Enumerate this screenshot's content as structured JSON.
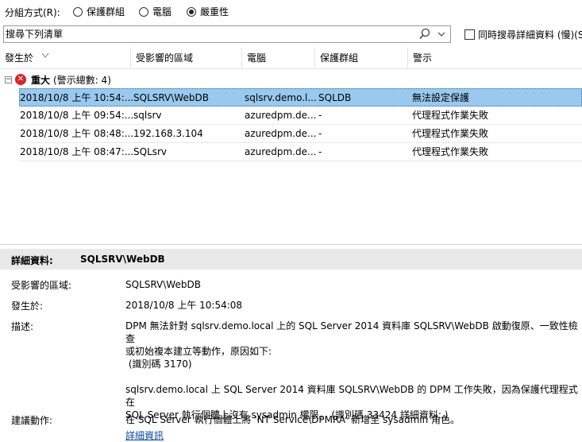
{
  "group_by": {
    "label": "分組方式(R):",
    "options": [
      {
        "label": "保護群組",
        "selected": false
      },
      {
        "label": "電腦",
        "selected": false
      },
      {
        "label": "嚴重性",
        "selected": true
      }
    ]
  },
  "search": {
    "placeholder": "搜尋下列清單",
    "detail_checkbox_label": "同時搜尋詳細資料 (慢)(S",
    "detail_checkbox_checked": false
  },
  "columns": [
    "發生於",
    "受影響的區域",
    "電腦",
    "保護群組",
    "警示"
  ],
  "group": {
    "title": "重大",
    "count_text": "(警示總數: 4)"
  },
  "rows": [
    {
      "time": "2018/10/8 上午 10:54:...",
      "area": "SQLSRV\\WebDB",
      "computer": "sqlsrv.demo.l...",
      "pg": "SQLDB",
      "alert": "無法設定保護",
      "selected": true
    },
    {
      "time": "2018/10/8 上午 09:54:...",
      "area": "sqlsrv",
      "computer": "azuredpm.de...",
      "pg": "-",
      "alert": "代理程式作業失敗",
      "selected": false
    },
    {
      "time": "2018/10/8 上午 08:48:...",
      "area": "192.168.3.104",
      "computer": "azuredpm.de...",
      "pg": "-",
      "alert": "代理程式作業失敗",
      "selected": false
    },
    {
      "time": "2018/10/8 上午 08:47:...",
      "area": "SQLsrv",
      "computer": "azuredpm.de...",
      "pg": "-",
      "alert": "代理程式作業失敗",
      "selected": false
    }
  ],
  "details": {
    "header_label": "詳細資料:",
    "header_value": "SQLSRV\\WebDB",
    "affected_label": "受影響的區域:",
    "affected_value": "SQLSRV\\WebDB",
    "occurred_label": "發生於:",
    "occurred_value": "2018/10/8 上午 10:54:08",
    "desc_label": "描述:",
    "desc_line1": "DPM 無法針對 sqlsrv.demo.local 上的 SQL Server 2014 資料庫 SQLSRV\\WebDB 啟動復原、一致性檢查",
    "desc_line2": "或初始複本建立等動作，原因如下:",
    "desc_line3": " (識別碼 3170)",
    "desc_line4": "sqlsrv.demo.local 上 SQL Server 2014 資料庫 SQLSRV\\WebDB 的 DPM 工作失敗，因為保護代理程式在",
    "desc_line5": "SQL Server 執行個體上沒有 sysadmin 權限。 (識別碼 33424 詳細資料: )",
    "more_info_link": "詳細資訊",
    "action_label": "建議動作:",
    "action_value": "在 SQL Server 執行個體上將 'NT Service\\DPMRA' 新增至 sysadmin 角色。"
  }
}
